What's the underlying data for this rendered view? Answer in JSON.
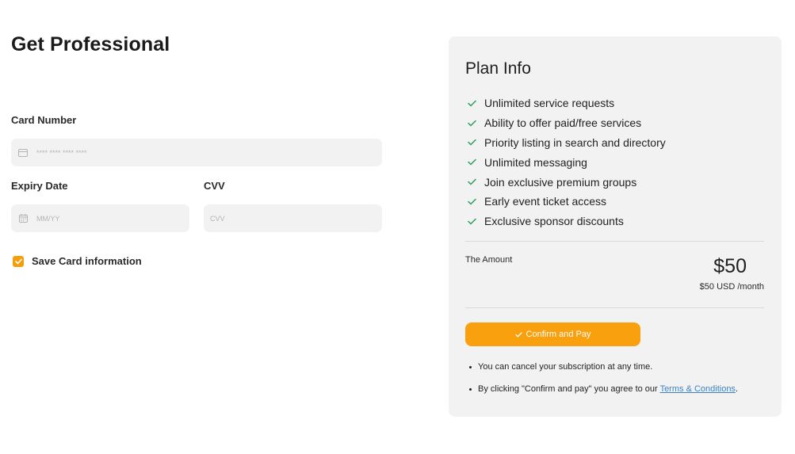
{
  "page": {
    "title": "Get Professional"
  },
  "form": {
    "card_number_label": "Card Number",
    "card_number_placeholder": "**** **** **** ****",
    "expiry_label": "Expiry Date",
    "expiry_placeholder": "MM/YY",
    "cvv_label": "CVV",
    "cvv_placeholder": "CVV",
    "save_card_label": "Save Card information",
    "save_card_checked": true
  },
  "plan": {
    "title": "Plan Info",
    "features": [
      "Unlimited service requests",
      "Ability to offer paid/free services",
      "Priority listing in search and directory",
      "Unlimited messaging",
      "Join exclusive premium groups",
      "Early event ticket access",
      "Exclusive sponsor discounts"
    ],
    "amount_label": "The Amount",
    "amount_value": "$50",
    "amount_sub": "$50 USD /month",
    "confirm_button_label": "Confirm and Pay",
    "notes": {
      "cancel_note": "You can cancel your subscription at any time.",
      "agree_prefix": "By clicking \"Confirm and pay\" you agree to our ",
      "terms_link": "Terms & Conditions",
      "agree_suffix": "."
    }
  },
  "colors": {
    "accent": "#f8a00d",
    "check_green": "#2e9e5b",
    "card_bg": "#f2f2f2",
    "input_bg": "#f2f2f2",
    "link": "#3b82c4"
  },
  "icons": {
    "card_input": "credit-card-icon",
    "expiry_input": "calendar-icon",
    "feature_check": "checkmark-icon",
    "button": "checkmark-icon"
  }
}
